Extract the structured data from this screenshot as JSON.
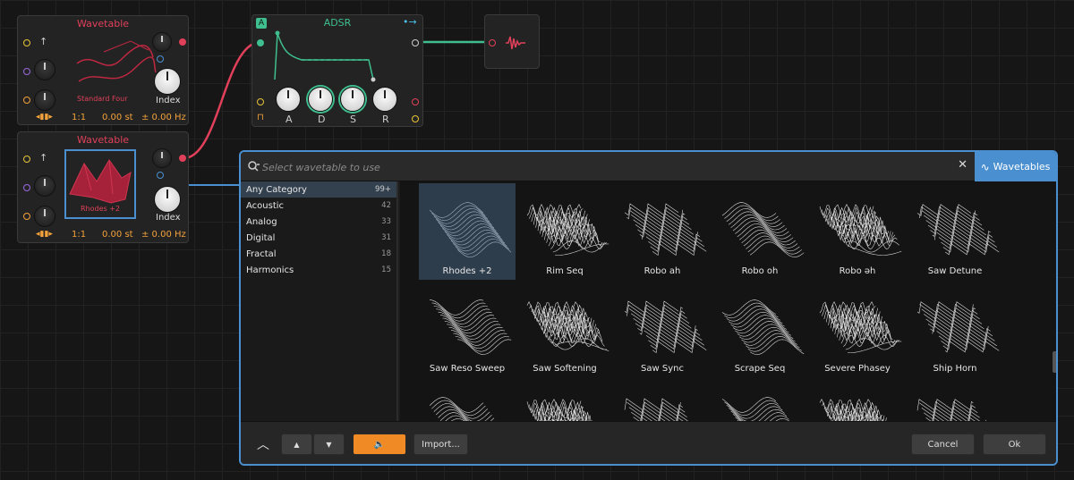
{
  "modules": {
    "wt1": {
      "title": "Wavetable",
      "preset": "Standard Four",
      "index_label": "Index",
      "ratio": "1:1",
      "st": "0.00 st",
      "hz": "± 0.00 Hz"
    },
    "wt2": {
      "title": "Wavetable",
      "preset": "Rhodes +2",
      "index_label": "Index",
      "ratio": "1:1",
      "st": "0.00 st",
      "hz": "± 0.00 Hz"
    },
    "adsr": {
      "title": "ADSR",
      "badge": "A",
      "knobs": [
        "A",
        "D",
        "S",
        "R"
      ]
    }
  },
  "browser": {
    "search_placeholder": "Select wavetable to use",
    "tab_label": "Wavetables",
    "categories": [
      {
        "name": "Any Category",
        "count": "99+"
      },
      {
        "name": "Acoustic",
        "count": "42"
      },
      {
        "name": "Analog",
        "count": "33"
      },
      {
        "name": "Digital",
        "count": "31"
      },
      {
        "name": "Fractal",
        "count": "18"
      },
      {
        "name": "Harmonics",
        "count": "15"
      }
    ],
    "tiles": [
      "Rhodes +2",
      "Rim Seq",
      "Robo ah",
      "Robo oh",
      "Robo əh",
      "Saw Detune",
      "Saw Reso Sweep",
      "Saw Softening",
      "Saw Sync",
      "Scrape Seq",
      "Severe Phasey",
      "Ship Horn",
      "",
      "",
      "",
      "",
      "",
      ""
    ],
    "footer": {
      "up_icon": "chevron-up-icon",
      "import_label": "Import...",
      "cancel_label": "Cancel",
      "ok_label": "Ok"
    }
  },
  "colors": {
    "accent_blue": "#4a8fd0",
    "accent_orange": "#f08a24",
    "wave_red": "#e0405a",
    "env_green": "#3fbf8f"
  }
}
